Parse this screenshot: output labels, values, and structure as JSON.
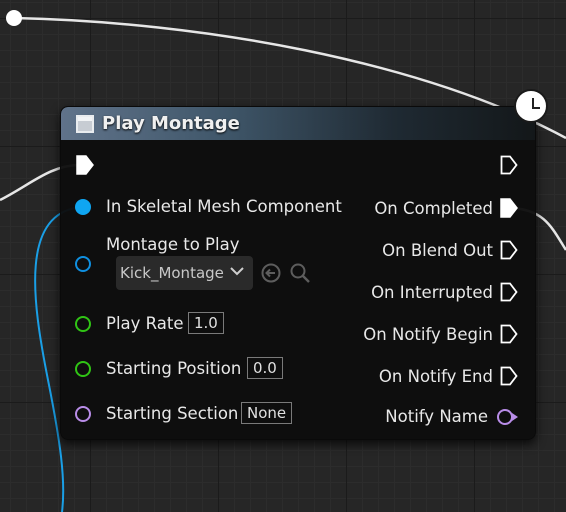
{
  "node": {
    "title": "Play Montage",
    "title_icon": "function-icon",
    "latent_icon": "clock-icon",
    "header_color": "#4a6074"
  },
  "inputs": {
    "mesh": {
      "label": "In Skeletal Mesh Component",
      "color": "#0fa6f2"
    },
    "montage": {
      "label": "Montage to Play",
      "value": "Kick_Montage",
      "color": "#0f8fe0"
    },
    "play_rate": {
      "label": "Play Rate",
      "value": "1.0",
      "color": "#30c415"
    },
    "starting_position": {
      "label": "Starting Position",
      "value": "0.0",
      "color": "#30c415"
    },
    "starting_section": {
      "label": "Starting Section",
      "value": "None",
      "color": "#b98de8"
    }
  },
  "outputs": {
    "on_completed": "On Completed",
    "on_blend_out": "On Blend Out",
    "on_interrupted": "On Interrupted",
    "on_notify_begin": "On Notify Begin",
    "on_notify_end": "On Notify End",
    "notify_name": "Notify Name"
  },
  "colors": {
    "exec": "#ffffff",
    "object_pin": "#0fa6f2",
    "float_pin": "#30c415",
    "name_pin": "#b98de8"
  }
}
